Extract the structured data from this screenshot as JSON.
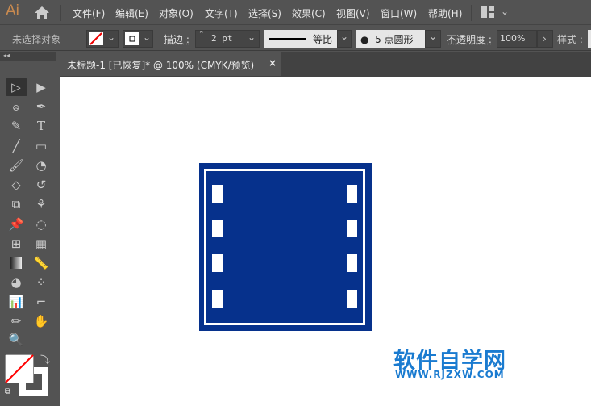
{
  "app": {
    "logo": "Ai"
  },
  "menu": [
    "文件(F)",
    "编辑(E)",
    "对象(O)",
    "文字(T)",
    "选择(S)",
    "效果(C)",
    "视图(V)",
    "窗口(W)",
    "帮助(H)"
  ],
  "control": {
    "selection": "未选择对象",
    "stroke_label": "描边 :",
    "stroke_value": "2 pt",
    "profile_label": "等比",
    "brush": "5 点圆形",
    "opacity_label": "不透明度 :",
    "opacity_value": "100%",
    "style_label": "样式 :"
  },
  "tab": {
    "title": "未标题-1 [已恢复]* @ 100% (CMYK/预览)",
    "close": "×"
  },
  "tools": [
    "selection",
    "direct-selection",
    "magic-wand",
    "pen",
    "curvature",
    "type",
    "line",
    "rectangle",
    "paintbrush",
    "shaper",
    "eraser",
    "rotate",
    "scale",
    "puppet-warp",
    "pin",
    "lasso",
    "perspective",
    "mesh",
    "gradient",
    "measure",
    "shape-builder",
    "symbol-sprayer",
    "graph",
    "artboard",
    "pencil",
    "hand",
    "zoom"
  ],
  "colors": {
    "artwork": "#06318c",
    "fill": "#ffffff",
    "stroke": "#ff0000"
  },
  "watermark": {
    "name": "软件自学网",
    "url": "WWW.RJZXW.COM"
  }
}
